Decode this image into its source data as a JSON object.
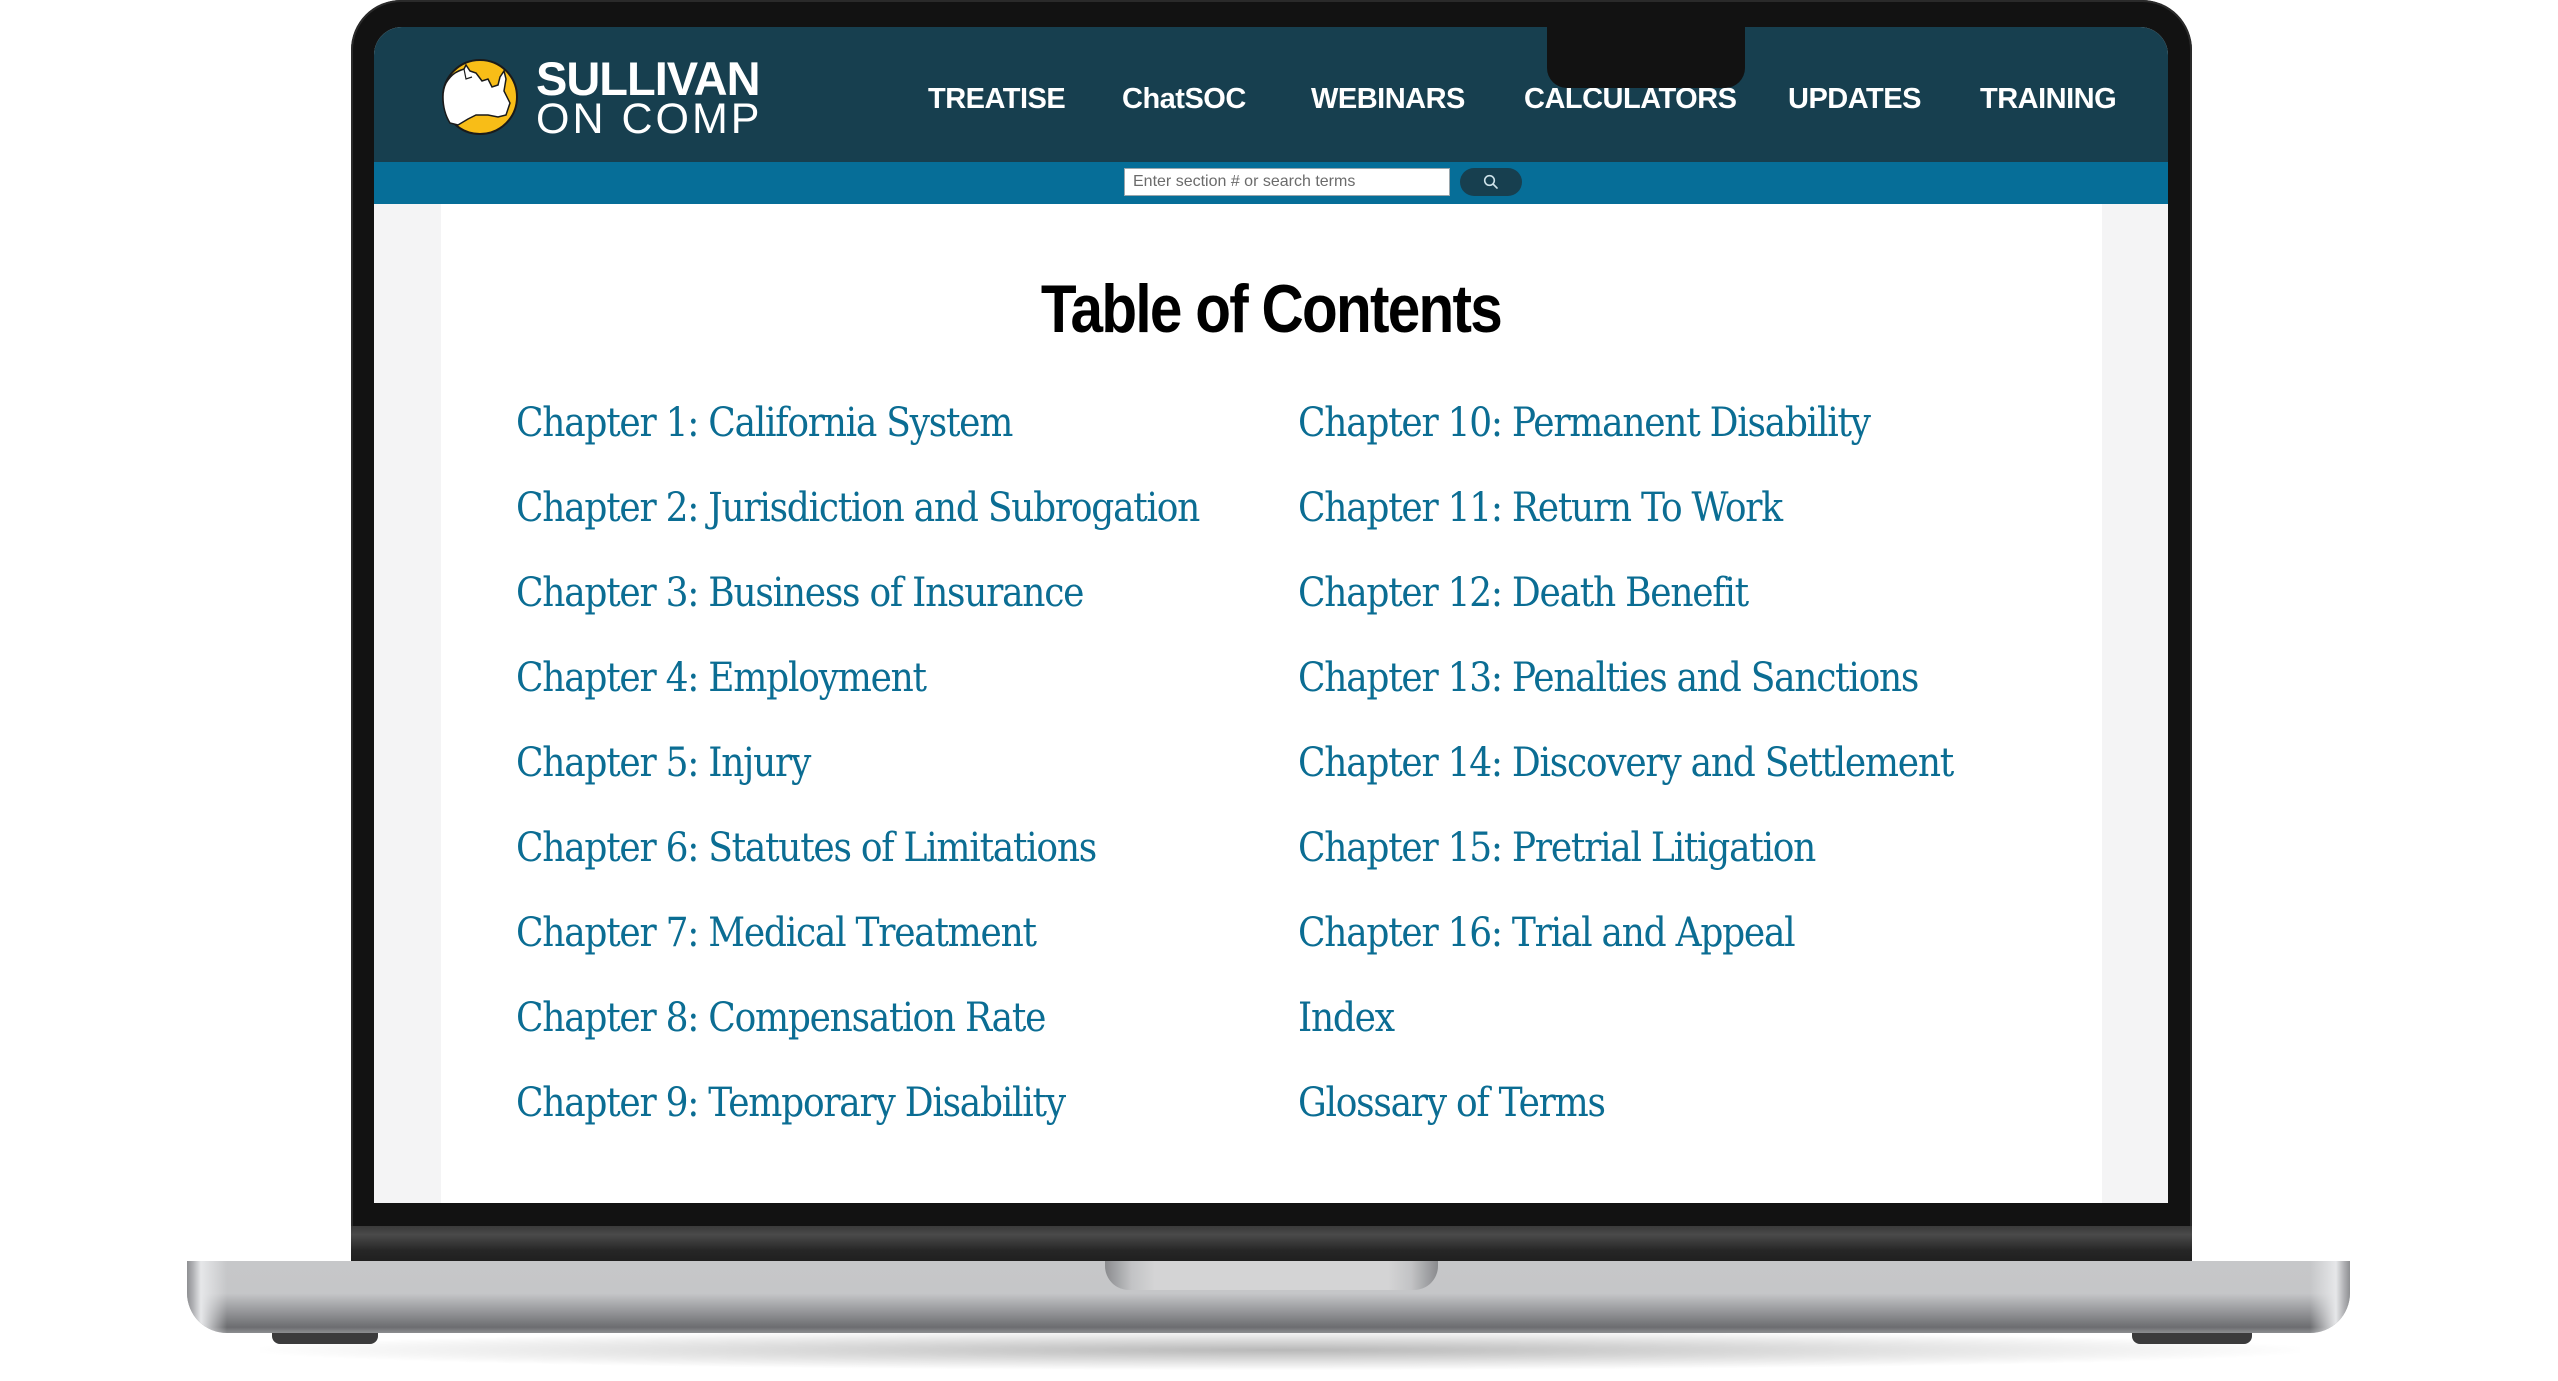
{
  "brand": {
    "name_line1": "SULLIVAN",
    "name_line2": "ON COMP",
    "logo_icon": "rhino-logo-icon",
    "colors": {
      "header_bg": "#173f4f",
      "search_band_bg": "#066e98",
      "link": "#0b6d93",
      "logo_yellow": "#f8bd17"
    }
  },
  "nav": {
    "items": [
      {
        "label": "TREATISE"
      },
      {
        "label": "ChatSOC"
      },
      {
        "label": "WEBINARS"
      },
      {
        "label": "CALCULATORS"
      },
      {
        "label": "UPDATES"
      },
      {
        "label": "TRAINING"
      }
    ]
  },
  "search": {
    "placeholder": "Enter section # or search terms",
    "value": "",
    "button_icon": "search-icon"
  },
  "main": {
    "title": "Table of Contents",
    "left_column": [
      {
        "label": "Chapter 1: California System"
      },
      {
        "label": "Chapter 2: Jurisdiction and Subrogation"
      },
      {
        "label": "Chapter 3: Business of Insurance"
      },
      {
        "label": "Chapter 4: Employment"
      },
      {
        "label": "Chapter 5: Injury"
      },
      {
        "label": "Chapter 6: Statutes of Limitations"
      },
      {
        "label": "Chapter 7: Medical Treatment"
      },
      {
        "label": "Chapter 8: Compensation Rate"
      },
      {
        "label": "Chapter 9: Temporary Disability"
      }
    ],
    "right_column": [
      {
        "label": "Chapter 10: Permanent Disability"
      },
      {
        "label": "Chapter 11: Return To Work"
      },
      {
        "label": "Chapter 12: Death Benefit"
      },
      {
        "label": "Chapter 13: Penalties and Sanctions"
      },
      {
        "label": "Chapter 14: Discovery and Settlement"
      },
      {
        "label": "Chapter 15: Pretrial Litigation"
      },
      {
        "label": "Chapter 16: Trial and Appeal"
      },
      {
        "label": "Index"
      },
      {
        "label": "Glossary of Terms"
      }
    ]
  }
}
